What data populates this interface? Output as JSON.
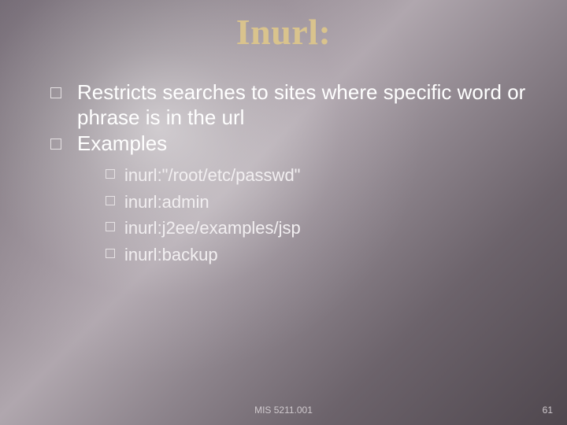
{
  "slide": {
    "title": "Inurl:",
    "bullets": [
      {
        "text": "Restricts searches to sites where specific word or phrase is in the url"
      },
      {
        "text": "Examples",
        "sub": [
          "inurl:\"/root/etc/passwd\"",
          "inurl:admin",
          "inurl:j2ee/examples/jsp",
          "inurl:backup"
        ]
      }
    ],
    "footer": {
      "course": "MIS 5211.001",
      "page": "61"
    }
  }
}
